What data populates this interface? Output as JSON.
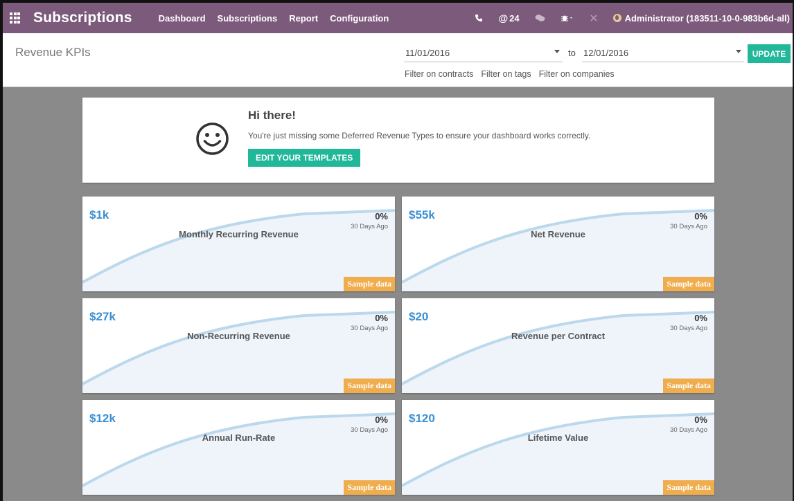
{
  "navbar": {
    "brand": "Subscriptions",
    "menu": [
      "Dashboard",
      "Subscriptions",
      "Report",
      "Configuration"
    ],
    "counter": "24",
    "user": "Administrator (183511-10-0-983b6d-all)",
    "icons": [
      "apps-grid-icon",
      "phone-icon",
      "at-sign-icon",
      "chat-bubbles-icon",
      "bug-icon",
      "tools-icon",
      "globe-icon"
    ],
    "color": "#7c5a7b"
  },
  "control_panel": {
    "title": "Revenue KPIs",
    "date_from": "11/01/2016",
    "to_label": "to",
    "date_to": "12/01/2016",
    "update_label": "UPDATE",
    "filters": [
      "Filter on contracts",
      "Filter on tags",
      "Filter on companies"
    ]
  },
  "hi_card": {
    "title": "Hi there!",
    "message": "You're just missing some Deferred Revenue Types to ensure your dashboard works correctly.",
    "button_label": "EDIT YOUR TEMPLATES",
    "icon": "smiley-icon"
  },
  "kpis": [
    {
      "value": "$1k",
      "name": "Monthly Recurring Revenue",
      "pct": "0%",
      "ago": "30 Days Ago",
      "badge": "Sample data"
    },
    {
      "value": "$55k",
      "name": "Net Revenue",
      "pct": "0%",
      "ago": "30 Days Ago",
      "badge": "Sample data"
    },
    {
      "value": "$27k",
      "name": "Non-Recurring Revenue",
      "pct": "0%",
      "ago": "30 Days Ago",
      "badge": "Sample data"
    },
    {
      "value": "$20",
      "name": "Revenue per Contract",
      "pct": "0%",
      "ago": "30 Days Ago",
      "badge": "Sample data"
    },
    {
      "value": "$12k",
      "name": "Annual Run-Rate",
      "pct": "0%",
      "ago": "30 Days Ago",
      "badge": "Sample data"
    },
    {
      "value": "$120",
      "name": "Lifetime Value",
      "pct": "0%",
      "ago": "30 Days Ago",
      "badge": "Sample data"
    }
  ],
  "colors": {
    "accent": "#21b799",
    "kpi_value": "#3a8fd4",
    "badge": "#f0ad4e",
    "background": "#8a8a8a"
  }
}
